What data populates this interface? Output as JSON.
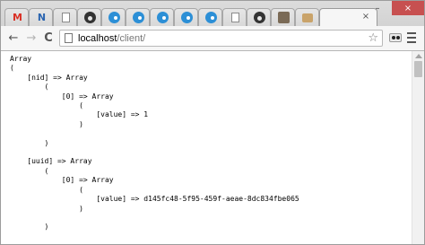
{
  "browser": {
    "tabs": [
      {
        "favicon": "gmail-icon",
        "glyph": "M"
      },
      {
        "favicon": "code-icon",
        "glyph": "N"
      },
      {
        "favicon": "document-icon",
        "glyph": ""
      },
      {
        "favicon": "github-icon",
        "glyph": ""
      },
      {
        "favicon": "drupal-icon",
        "glyph": ""
      },
      {
        "favicon": "drupal-icon",
        "glyph": ""
      },
      {
        "favicon": "drupal-icon",
        "glyph": ""
      },
      {
        "favicon": "drupal-icon",
        "glyph": ""
      },
      {
        "favicon": "drupal-icon",
        "glyph": ""
      },
      {
        "favicon": "document-icon",
        "glyph": ""
      },
      {
        "favicon": "github-icon",
        "glyph": ""
      },
      {
        "favicon": "dog-icon",
        "glyph": ""
      },
      {
        "favicon": "box-icon",
        "glyph": ""
      }
    ],
    "active_tab_close": "×",
    "window_controls": {
      "minimize": "–",
      "close": "×"
    }
  },
  "toolbar": {
    "back": "←",
    "forward": "→",
    "reload": "C",
    "url_host": "localhost",
    "url_path": "/client/",
    "star": "☆"
  },
  "page": {
    "dump": "Array\n(\n    [nid] => Array\n        (\n            [0] => Array\n                (\n                    [value] => 1\n                )\n\n        )\n\n    [uuid] => Array\n        (\n            [0] => Array\n                (\n                    [value] => d145fc48-5f95-459f-aeae-8dc834fbe065\n                )\n\n        )\n"
  }
}
